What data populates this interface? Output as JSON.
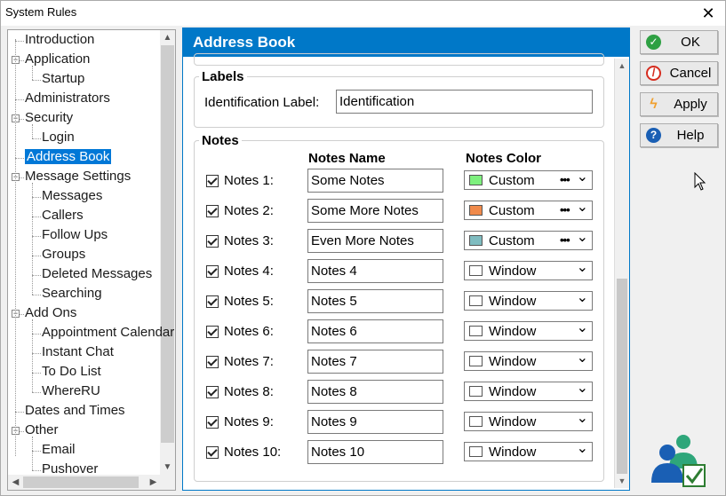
{
  "window": {
    "title": "System Rules",
    "close_glyph": "✕"
  },
  "tree": {
    "items": [
      {
        "label": "Introduction",
        "level": 0
      },
      {
        "label": "Application",
        "level": 0
      },
      {
        "label": "Startup",
        "level": 1
      },
      {
        "label": "Administrators",
        "level": 0
      },
      {
        "label": "Security",
        "level": 0
      },
      {
        "label": "Login",
        "level": 1
      },
      {
        "label": "Address Book",
        "level": 0,
        "selected": true
      },
      {
        "label": "Message Settings",
        "level": 0
      },
      {
        "label": "Messages",
        "level": 1
      },
      {
        "label": "Callers",
        "level": 1
      },
      {
        "label": "Follow Ups",
        "level": 1
      },
      {
        "label": "Groups",
        "level": 1
      },
      {
        "label": "Deleted Messages",
        "level": 1
      },
      {
        "label": "Searching",
        "level": 1
      },
      {
        "label": "Add Ons",
        "level": 0
      },
      {
        "label": "Appointment Calendar",
        "level": 1
      },
      {
        "label": "Instant Chat",
        "level": 1
      },
      {
        "label": "To Do List",
        "level": 1
      },
      {
        "label": "WhereRU",
        "level": 1
      },
      {
        "label": "Dates and Times",
        "level": 0
      },
      {
        "label": "Other",
        "level": 0
      },
      {
        "label": "Email",
        "level": 1
      },
      {
        "label": "Pushover",
        "level": 1
      }
    ]
  },
  "panel": {
    "title": "Address Book",
    "labels_group": {
      "title": "Labels",
      "identification_label": "Identification Label:",
      "identification_value": "Identification"
    },
    "notes_group": {
      "title": "Notes",
      "col_name": "Notes Name",
      "col_color": "Notes Color",
      "rows": [
        {
          "label": "Notes 1:",
          "checked": true,
          "name": "Some Notes",
          "color_text": "Custom",
          "swatch": "#7ef07e",
          "dots": "•••"
        },
        {
          "label": "Notes 2:",
          "checked": true,
          "name": "Some More Notes",
          "color_text": "Custom",
          "swatch": "#f08a4b",
          "dots": "•••"
        },
        {
          "label": "Notes 3:",
          "checked": true,
          "name": "Even More Notes",
          "color_text": "Custom",
          "swatch": "#7fbcc0",
          "dots": "•••"
        },
        {
          "label": "Notes 4:",
          "checked": true,
          "name": "Notes 4",
          "color_text": "Window",
          "swatch": "#ffffff",
          "dots": ""
        },
        {
          "label": "Notes 5:",
          "checked": true,
          "name": "Notes 5",
          "color_text": "Window",
          "swatch": "#ffffff",
          "dots": ""
        },
        {
          "label": "Notes 6:",
          "checked": true,
          "name": "Notes 6",
          "color_text": "Window",
          "swatch": "#ffffff",
          "dots": ""
        },
        {
          "label": "Notes 7:",
          "checked": true,
          "name": "Notes 7",
          "color_text": "Window",
          "swatch": "#ffffff",
          "dots": ""
        },
        {
          "label": "Notes 8:",
          "checked": true,
          "name": "Notes 8",
          "color_text": "Window",
          "swatch": "#ffffff",
          "dots": ""
        },
        {
          "label": "Notes 9:",
          "checked": true,
          "name": "Notes 9",
          "color_text": "Window",
          "swatch": "#ffffff",
          "dots": ""
        },
        {
          "label": "Notes 10:",
          "checked": true,
          "name": "Notes 10",
          "color_text": "Window",
          "swatch": "#ffffff",
          "dots": ""
        }
      ]
    }
  },
  "buttons": {
    "ok": {
      "label": "OK",
      "icon": "check-icon",
      "color": "#2ea043"
    },
    "cancel": {
      "label": "Cancel",
      "icon": "no-entry-icon",
      "color": "#d62d20"
    },
    "apply": {
      "label": "Apply",
      "icon": "lightning-icon",
      "color": "#f0a030"
    },
    "help": {
      "label": "Help",
      "icon": "question-icon",
      "color": "#1a5fb4"
    }
  },
  "colors": {
    "accent": "#0078c8",
    "selection": "#0078d7"
  }
}
